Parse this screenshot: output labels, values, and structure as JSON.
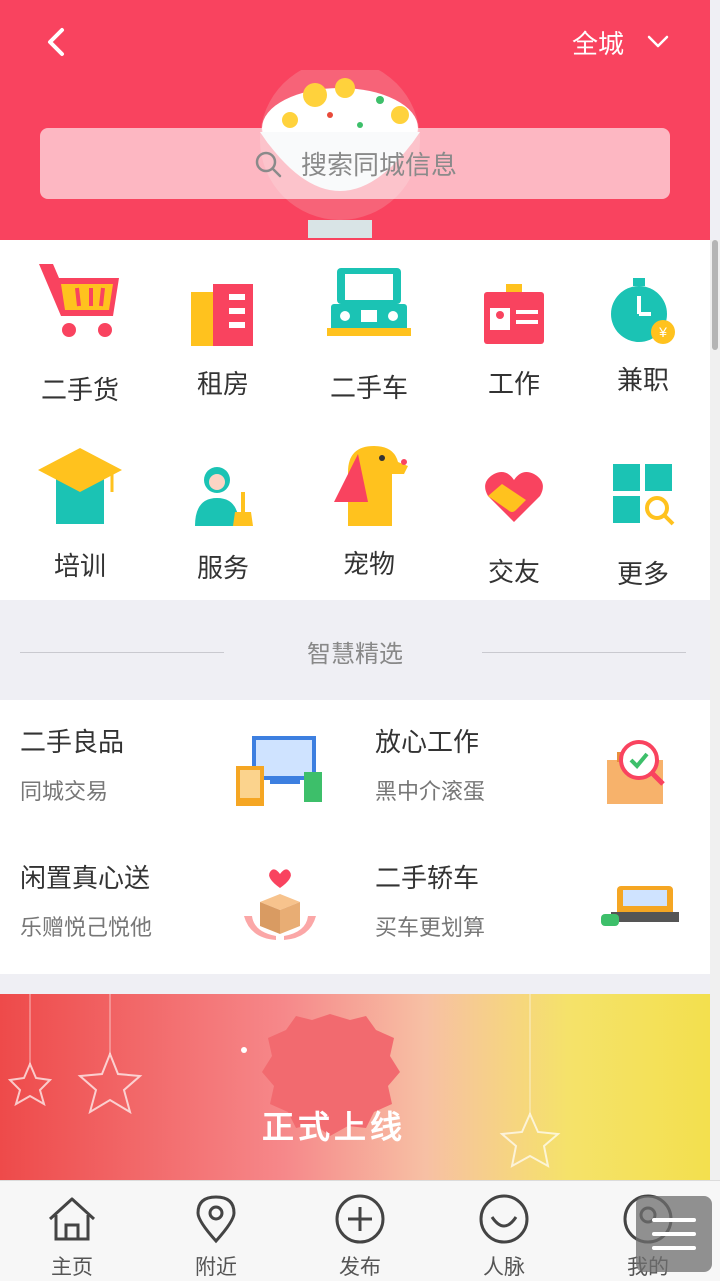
{
  "header": {
    "city": "全城",
    "search_placeholder": "搜索同城信息",
    "accent_color": "#f9435f"
  },
  "categories": [
    {
      "label": "二手货",
      "icon": "shopping-cart-icon"
    },
    {
      "label": "租房",
      "icon": "building-icon"
    },
    {
      "label": "二手车",
      "icon": "truck-icon"
    },
    {
      "label": "工作",
      "icon": "id-card-icon"
    },
    {
      "label": "兼职",
      "icon": "clock-money-icon"
    },
    {
      "label": "培训",
      "icon": "graduation-cap-icon"
    },
    {
      "label": "服务",
      "icon": "service-worker-icon"
    },
    {
      "label": "宠物",
      "icon": "dog-icon"
    },
    {
      "label": "交友",
      "icon": "handshake-heart-icon"
    },
    {
      "label": "更多",
      "icon": "grid-search-icon"
    }
  ],
  "section": {
    "title": "智慧精选"
  },
  "picks": [
    {
      "title": "二手良品",
      "subtitle": "同城交易",
      "icon": "devices-icon"
    },
    {
      "title": "放心工作",
      "subtitle": "黑中介滚蛋",
      "icon": "search-briefcase-icon"
    },
    {
      "title": "闲置真心送",
      "subtitle": "乐赠悦己悦他",
      "icon": "gift-box-icon"
    },
    {
      "title": "二手轿车",
      "subtitle": "买车更划算",
      "icon": "car-icon"
    }
  ],
  "banner": {
    "text": "正式上线"
  },
  "tabbar": [
    {
      "label": "主页",
      "icon": "home-icon"
    },
    {
      "label": "附近",
      "icon": "location-pin-icon"
    },
    {
      "label": "发布",
      "icon": "plus-circle-icon"
    },
    {
      "label": "人脉",
      "icon": "contacts-icon"
    },
    {
      "label": "我的",
      "icon": "user-icon"
    }
  ]
}
